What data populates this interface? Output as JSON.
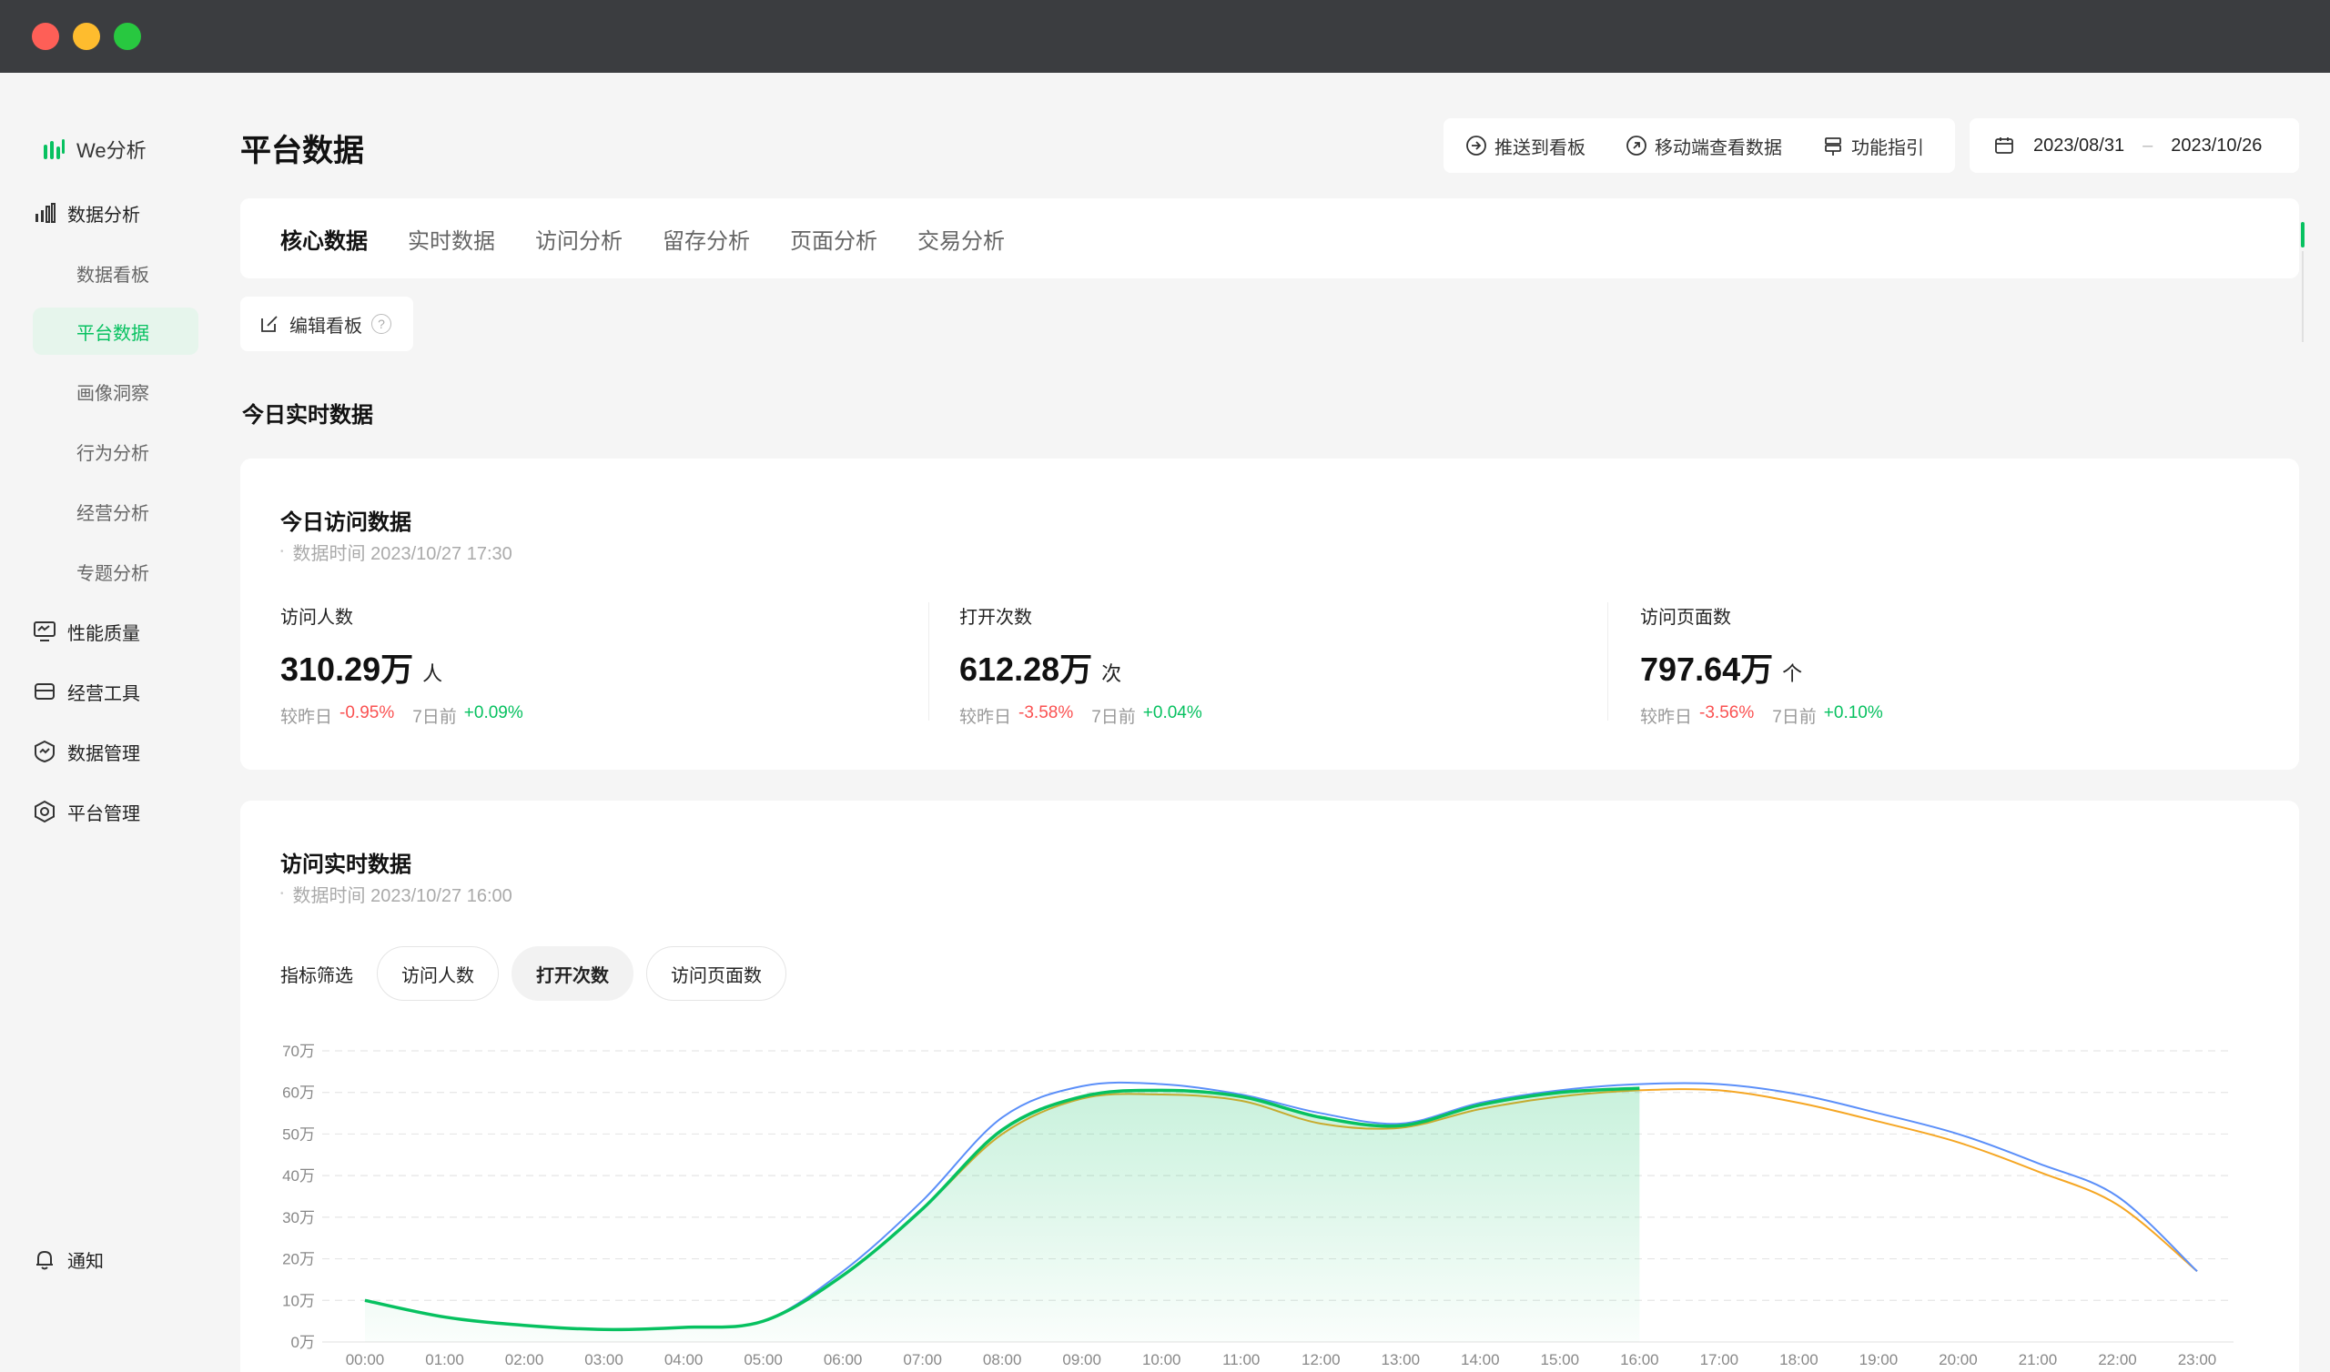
{
  "sidebar": {
    "logo_text": "We分析",
    "items": [
      {
        "label": "数据分析",
        "icon": "bar-chart-icon"
      },
      {
        "label": "性能质量",
        "icon": "monitor-icon"
      },
      {
        "label": "经营工具",
        "icon": "wallet-icon"
      },
      {
        "label": "数据管理",
        "icon": "shield-icon"
      },
      {
        "label": "平台管理",
        "icon": "hexagon-icon"
      }
    ],
    "sub_items": [
      {
        "label": "数据看板"
      },
      {
        "label": "平台数据",
        "active": true
      },
      {
        "label": "画像洞察"
      },
      {
        "label": "行为分析"
      },
      {
        "label": "经营分析"
      },
      {
        "label": "专题分析"
      }
    ],
    "notify_label": "通知"
  },
  "header": {
    "title": "平台数据",
    "push_label": "推送到看板",
    "mobile_label": "移动端查看数据",
    "guide_label": "功能指引",
    "date_start": "2023/08/31",
    "date_sep": "–",
    "date_end": "2023/10/26"
  },
  "tabs": [
    {
      "label": "核心数据",
      "active": true
    },
    {
      "label": "实时数据"
    },
    {
      "label": "访问分析"
    },
    {
      "label": "留存分析"
    },
    {
      "label": "页面分析"
    },
    {
      "label": "交易分析"
    }
  ],
  "edit_board_label": "编辑看板",
  "help_glyph": "?",
  "section_title": "今日实时数据",
  "visits_card": {
    "title": "今日访问数据",
    "time_text": "数据时间 2023/10/27 17:30",
    "metrics": [
      {
        "label": "访问人数",
        "value": "310.29万",
        "unit": "人",
        "vs_yesterday_label": "较昨日",
        "vs_yesterday": "-0.95%",
        "vs_week_label": "7日前",
        "vs_week": "+0.09%"
      },
      {
        "label": "打开次数",
        "value": "612.28万",
        "unit": "次",
        "vs_yesterday_label": "较昨日",
        "vs_yesterday": "-3.58%",
        "vs_week_label": "7日前",
        "vs_week": "+0.04%"
      },
      {
        "label": "访问页面数",
        "value": "797.64万",
        "unit": "个",
        "vs_yesterday_label": "较昨日",
        "vs_yesterday": "-3.56%",
        "vs_week_label": "7日前",
        "vs_week": "+0.10%"
      }
    ]
  },
  "realtime_card": {
    "title": "访问实时数据",
    "time_text": "数据时间 2023/10/27 16:00",
    "filter_label": "指标筛选",
    "filters": [
      {
        "label": "访问人数"
      },
      {
        "label": "打开次数",
        "active": true
      },
      {
        "label": "访问页面数"
      }
    ]
  },
  "colors": {
    "brand_green": "#07c160",
    "blue_line": "#5b8ff9",
    "orange_line": "#f5a623",
    "negative": "#fa5151"
  },
  "chart_data": {
    "type": "line",
    "y_ticks": [
      "0万",
      "10万",
      "20万",
      "30万",
      "40万",
      "50万",
      "60万",
      "70万"
    ],
    "ylim": [
      0,
      70
    ],
    "categories": [
      "00:00",
      "01:00",
      "02:00",
      "03:00",
      "04:00",
      "05:00",
      "06:00",
      "07:00",
      "08:00",
      "09:00",
      "10:00",
      "11:00",
      "12:00",
      "13:00",
      "14:00",
      "15:00",
      "16:00",
      "17:00",
      "18:00",
      "19:00",
      "20:00",
      "21:00",
      "22:00",
      "23:00"
    ],
    "grid": true,
    "series": [
      {
        "color": "#07c160",
        "area": true,
        "values": [
          10,
          6,
          4,
          3,
          3.5,
          5,
          16,
          32,
          51,
          59,
          60.5,
          59,
          54,
          52,
          57,
          60,
          61
        ]
      },
      {
        "color": "#5b8ff9",
        "values": [
          10,
          6,
          4,
          3,
          3.5,
          5,
          17,
          34,
          54,
          61.5,
          62,
          59.5,
          55,
          52.5,
          57.5,
          60.5,
          62,
          62,
          59.5,
          55,
          50,
          43,
          35,
          17
        ]
      },
      {
        "color": "#f5a623",
        "values": [
          10,
          6,
          4,
          3,
          3.5,
          5,
          16,
          32,
          50,
          58.5,
          59.5,
          58,
          52.5,
          51.5,
          56,
          59,
          60.5,
          60.5,
          57.5,
          53,
          48,
          41,
          33,
          17
        ]
      }
    ]
  }
}
